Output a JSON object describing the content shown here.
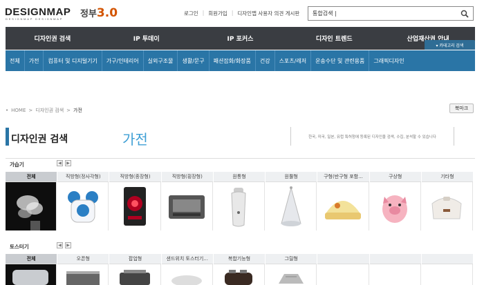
{
  "brand": {
    "logo": "DESIGNMAP",
    "logo_sub": "DESIGNMAP DESIGNMAP",
    "gov_text": "정부",
    "gov_version": "3.0"
  },
  "toplinks": [
    "로그인",
    "회원가입",
    "디자인맵 사용자 의견 게시판"
  ],
  "search": {
    "value": "통합검색 |",
    "placeholder": ""
  },
  "mainnav": [
    "디자인권 검색",
    "IP 투데이",
    "IP 포커스",
    "디자인 트렌드",
    "산업재산권 안내"
  ],
  "category_button": "▾ 카테고리 검색",
  "subnav": [
    "전체",
    "가전",
    "컴퓨터 및 디지털기기",
    "가구/인테리어",
    "실외구조물",
    "생활/문구",
    "패션잡화/화장품",
    "건강",
    "스포츠/레저",
    "운송수단 및 관련용품",
    "그래픽디자인"
  ],
  "breadcrumb": {
    "home": "HOME",
    "level1": "디자인권 검색",
    "current": "가전"
  },
  "bookmark": "북마크",
  "page": {
    "title": "디자인권 검색",
    "subtitle": "가전",
    "description": "한국, 미국, 일본, 유럽 특허청에 등록된 디자인을 검색, 수집, 분석할 수 있습니다"
  },
  "section1": {
    "label": "가습기",
    "items": [
      {
        "label": "전체",
        "icon": "steam-icon",
        "active": true
      },
      {
        "label": "직방형(정사각형)",
        "icon": "humidifier-mouse-icon"
      },
      {
        "label": "직방형(종장형)",
        "icon": "humidifier-red-icon"
      },
      {
        "label": "직방형(횡장형)",
        "icon": "humidifier-box-icon"
      },
      {
        "label": "원통형",
        "icon": "humidifier-cylinder-icon"
      },
      {
        "label": "원뿔형",
        "icon": "humidifier-cone-icon"
      },
      {
        "label": "구형(반구형 포함...",
        "icon": "humidifier-dome-icon"
      },
      {
        "label": "구상형",
        "icon": "humidifier-pig-icon"
      },
      {
        "label": "기타형",
        "icon": "humidifier-other-icon"
      }
    ]
  },
  "section2": {
    "label": "토스터기",
    "items": [
      {
        "label": "전체",
        "icon": "toaster-icon",
        "active": true
      },
      {
        "label": "오픈형",
        "icon": "toaster-open-icon"
      },
      {
        "label": "팝업형",
        "icon": "toaster-popup-icon"
      },
      {
        "label": "샌드위치 토스터기...",
        "icon": "toaster-sandwich-icon"
      },
      {
        "label": "복합기능형",
        "icon": "toaster-multi-icon"
      },
      {
        "label": "그릴형",
        "icon": "toaster-grill-icon"
      },
      {
        "label": "",
        "icon": ""
      },
      {
        "label": "",
        "icon": ""
      },
      {
        "label": "",
        "icon": ""
      }
    ]
  },
  "colors": {
    "nav_dark": "#3a3d42",
    "nav_blue": "#2a75a6",
    "accent": "#3e9fd5"
  }
}
